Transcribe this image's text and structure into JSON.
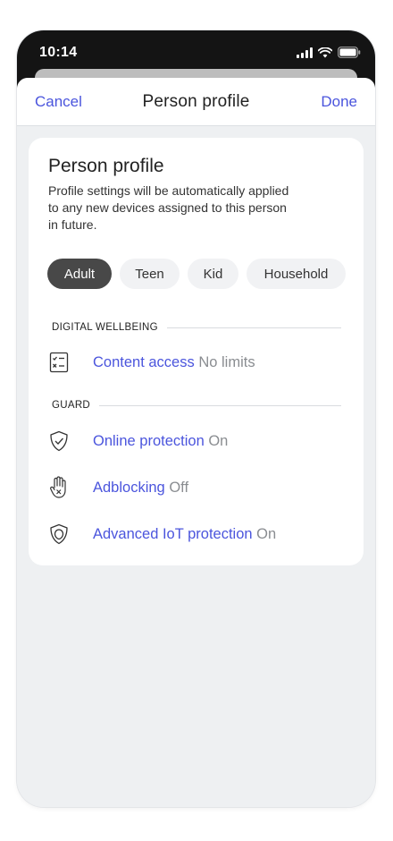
{
  "status_bar": {
    "time": "10:14"
  },
  "nav": {
    "cancel": "Cancel",
    "title": "Person profile",
    "done": "Done"
  },
  "card": {
    "title": "Person profile",
    "description": "Profile settings will be automatically applied to any new devices assigned to this person in future."
  },
  "profile_types": [
    {
      "label": "Adult",
      "selected": true
    },
    {
      "label": "Teen",
      "selected": false
    },
    {
      "label": "Kid",
      "selected": false
    },
    {
      "label": "Household",
      "selected": false
    }
  ],
  "sections": {
    "digital_wellbeing": {
      "header": "DIGITAL WELLBEING",
      "items": [
        {
          "icon": "checklist-icon",
          "label": "Content access",
          "value": "No limits"
        }
      ]
    },
    "guard": {
      "header": "GUARD",
      "items": [
        {
          "icon": "shield-check-icon",
          "label": "Online protection",
          "value": "On"
        },
        {
          "icon": "hand-block-icon",
          "label": "Adblocking",
          "value": "Off"
        },
        {
          "icon": "shield-iot-icon",
          "label": "Advanced IoT protection",
          "value": "On"
        }
      ]
    }
  },
  "colors": {
    "accent": "#4b55dd",
    "selected_chip": "#484848",
    "background": "#eef0f2",
    "muted_value": "#8a8d91"
  }
}
